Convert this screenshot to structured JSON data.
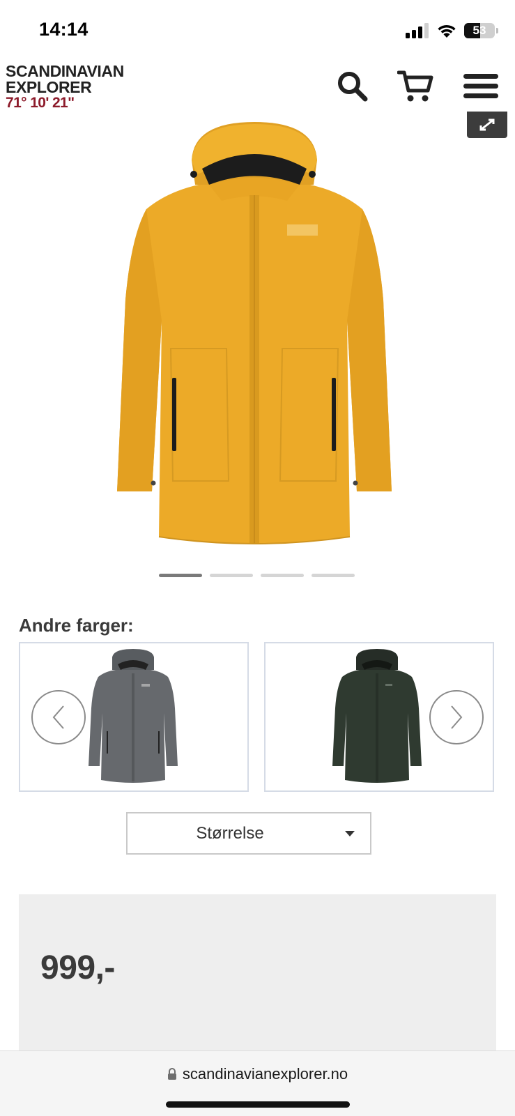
{
  "status": {
    "time": "14:14",
    "battery": "53",
    "battery_level": 0.53,
    "icons": [
      "signal-icon",
      "wifi-icon",
      "battery-icon"
    ]
  },
  "header": {
    "logo_line1": "SCANDINAVIAN",
    "logo_line2": "EXPLORER",
    "logo_coords": "71° 10' 21\"",
    "icons": [
      "search-icon",
      "cart-icon",
      "hamburger-menu-icon"
    ]
  },
  "product": {
    "image_icon": "yellow-rain-jacket",
    "expand_icon": "expand-icon",
    "carousel": {
      "count": 4,
      "active": 0
    }
  },
  "colors": {
    "title": "Andre farger:",
    "options": [
      {
        "icon": "grey-rain-jacket",
        "color": "#606468"
      },
      {
        "icon": "green-rain-jacket",
        "color": "#2f3a30"
      }
    ],
    "prev_icon": "chevron-left-icon",
    "next_icon": "chevron-right-icon"
  },
  "size_select": {
    "label": "Størrelse",
    "icon": "caret-down-icon"
  },
  "price": {
    "value": "999,-"
  },
  "browser": {
    "url": "scandinavianexplorer.no",
    "lock_icon": "lock-icon"
  },
  "theme": {
    "jacket_yellow": "#ecaa28",
    "brand_red": "#8d1b2b",
    "price_bg": "#eeeeee"
  }
}
